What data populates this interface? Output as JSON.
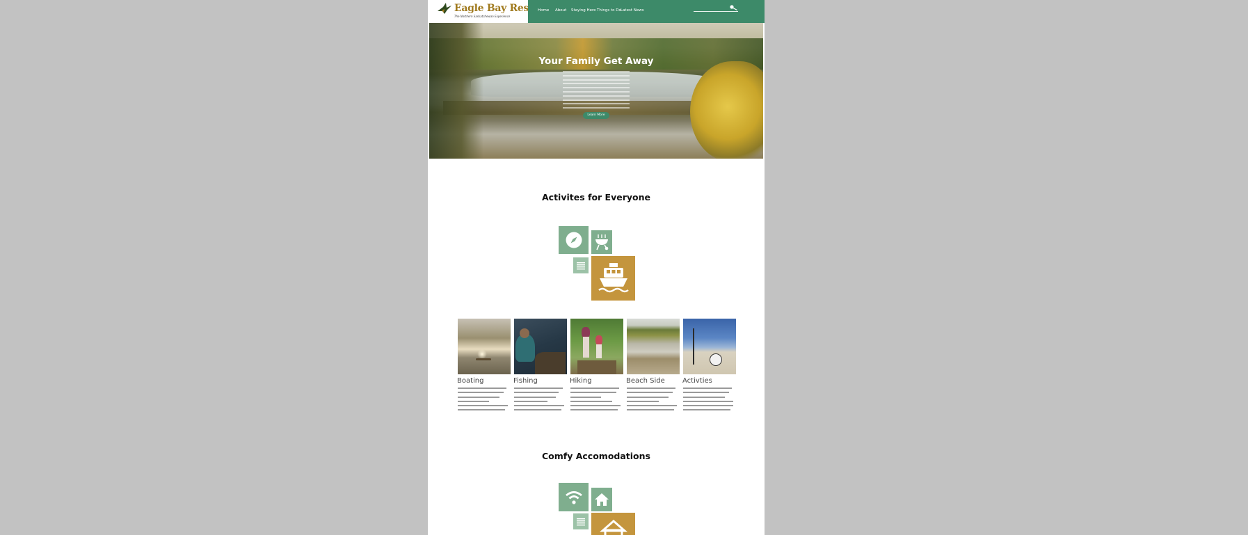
{
  "brand": {
    "name": "Eagle Bay Resort",
    "tagline": "The Northern Saskatchewan Experience"
  },
  "nav": {
    "items": [
      "Home",
      "About",
      "Staying Here",
      "Things to Do",
      "Latest News"
    ]
  },
  "hero": {
    "title": "Your Family Get Away",
    "button": "Learn More"
  },
  "activities": {
    "title": "Activites for Everyone",
    "icons": [
      "compass-icon",
      "grill-icon",
      "list-icon",
      "boat-icon"
    ],
    "cards": [
      {
        "title": "Boating"
      },
      {
        "title": "Fishing"
      },
      {
        "title": "Hiking"
      },
      {
        "title": "Beach Side"
      },
      {
        "title": "Activties"
      }
    ]
  },
  "accommodations": {
    "title": "Comfy Accomodations",
    "icons": [
      "wifi-icon",
      "house-icon",
      "list-icon",
      "home-icon"
    ]
  },
  "colors": {
    "accent_green": "#3d8a69",
    "tile_green": "#7fae8e",
    "tile_gold": "#c4953d",
    "brand_gold": "#a07a1e",
    "backdrop": "#c2c2c2"
  }
}
